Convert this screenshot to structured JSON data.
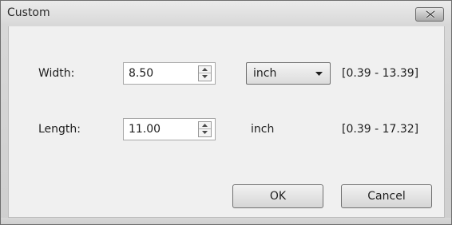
{
  "window": {
    "title": "Custom"
  },
  "fields": {
    "width": {
      "label": "Width:",
      "value": "8.50",
      "range": "[0.39 - 13.39]"
    },
    "length": {
      "label": "Length:",
      "value": "11.00",
      "range": "[0.39 - 17.32]"
    }
  },
  "units": {
    "selected": "inch",
    "static_label": "inch"
  },
  "buttons": {
    "ok": "OK",
    "cancel": "Cancel"
  },
  "icons": {
    "close": "close-icon",
    "spin_up": "arrow-up-icon",
    "spin_down": "arrow-down-icon",
    "dropdown": "chevron-down-icon"
  },
  "colors": {
    "window_bg": "#f0f0f0",
    "titlebar_top": "#ebebeb",
    "titlebar_bottom": "#d7d7d7",
    "text": "#1e1e1e"
  }
}
